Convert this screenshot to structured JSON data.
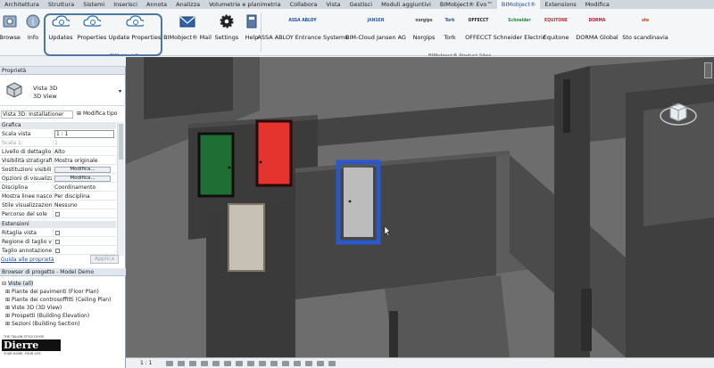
{
  "tabs": [
    "Architettura",
    "Struttura",
    "Sistemi",
    "Inserisci",
    "Annota",
    "Analizza",
    "Volumetrie e planimetria",
    "Collabora",
    "Vista",
    "Gestisci",
    "Moduli aggiuntivi",
    "BIMobject® Evo™",
    "BIMobject®",
    "Extensions",
    "Modifica"
  ],
  "ribbon": {
    "buttons": [
      {
        "label": "Browse",
        "icon": "browse-icon"
      },
      {
        "label": "Info",
        "icon": "info-icon"
      },
      {
        "label": "Updates",
        "icon": "cloud-updates-icon"
      },
      {
        "label": "Properties",
        "icon": "cloud-properties-icon"
      },
      {
        "label": "Update Properties",
        "icon": "cloud-update-properties-icon"
      },
      {
        "label": "BIMobject® Mail",
        "icon": "mail-icon"
      },
      {
        "label": "Settings",
        "icon": "gear-icon"
      },
      {
        "label": "Help",
        "icon": "help-icon"
      }
    ],
    "sites": [
      {
        "label": "ASSA ABLOY Entrance Systems",
        "logo": "ASSA ABLOY"
      },
      {
        "label": "BIM-Cloud Jansen AG",
        "logo": "JANSEN"
      },
      {
        "label": "Norgips",
        "logo": "norgips"
      },
      {
        "label": "Tork",
        "logo": "Tork"
      },
      {
        "label": "OFFECCT",
        "logo": "OFFECCT"
      },
      {
        "label": "Schneider Electric",
        "logo": "Schneider"
      },
      {
        "label": "Equitone",
        "logo": "EQUITONE"
      },
      {
        "label": "DORMA Global",
        "logo": "DORMA"
      },
      {
        "label": "Sto scandinavia",
        "logo": "sto"
      }
    ],
    "group1": "BIMobject®",
    "group2": "BIMobject® Product Sites"
  },
  "properties": {
    "title": "Proprietà",
    "type_name": "Vista 3D",
    "type_sub": "3D View",
    "selector": "Vista 3D: Installationer",
    "edit_type": "Modifica tipo",
    "section_graphics": "Grafica",
    "rows": [
      {
        "k": "Scala vista",
        "v": "1 : 1",
        "box": true
      },
      {
        "k": "Scala 1:",
        "v": "1",
        "grey": true
      },
      {
        "k": "Livello di dettaglio",
        "v": "Alto"
      },
      {
        "k": "Visibilità stratigrafia",
        "v": "Mostra originale"
      },
      {
        "k": "Sostituzioni visibilit...",
        "v": "Modifica...",
        "btn": true
      },
      {
        "k": "Opzioni di visualizz...",
        "v": "Modifica...",
        "btn": true
      },
      {
        "k": "Disciplina",
        "v": "Coordinamento"
      },
      {
        "k": "Mostra linee nasco...",
        "v": "Per disciplina"
      },
      {
        "k": "Stile visualizzazion...",
        "v": "Nessuno"
      },
      {
        "k": "Percorso del sole",
        "v": "",
        "chk": true
      }
    ],
    "section_extents": "Estensioni",
    "rows2": [
      {
        "k": "Ritaglia vista",
        "chk": true
      },
      {
        "k": "Regione di taglio vi...",
        "chk": true
      },
      {
        "k": "Taglio annotazione",
        "chk": true
      }
    ],
    "help_link": "Guida alle proprietà",
    "apply": "Applica"
  },
  "browser": {
    "title": "Browser di progetto - Model Demo",
    "root": "Viste (all)",
    "items": [
      "Piante dei pavimenti (Floor Plan)",
      "Piante dei controsoffitti (Ceiling Plan)",
      "Viste 3D (3D View)",
      "Prospetti (Building Elevation)",
      "Sezioni (Building Section)"
    ]
  },
  "brand": {
    "tagline": "THE ITALIAN STYLE DOOR",
    "name": "Dierre",
    "slogan": "YOUR HOME, YOUR LIFE"
  },
  "viewcube": {
    "face": "SUP"
  },
  "status": {
    "scale": "1 : 1"
  },
  "colors": {
    "accent": "#4a78a2",
    "door_green": "#1f6e33",
    "door_red": "#e5332d",
    "selection": "#2b57c7"
  }
}
